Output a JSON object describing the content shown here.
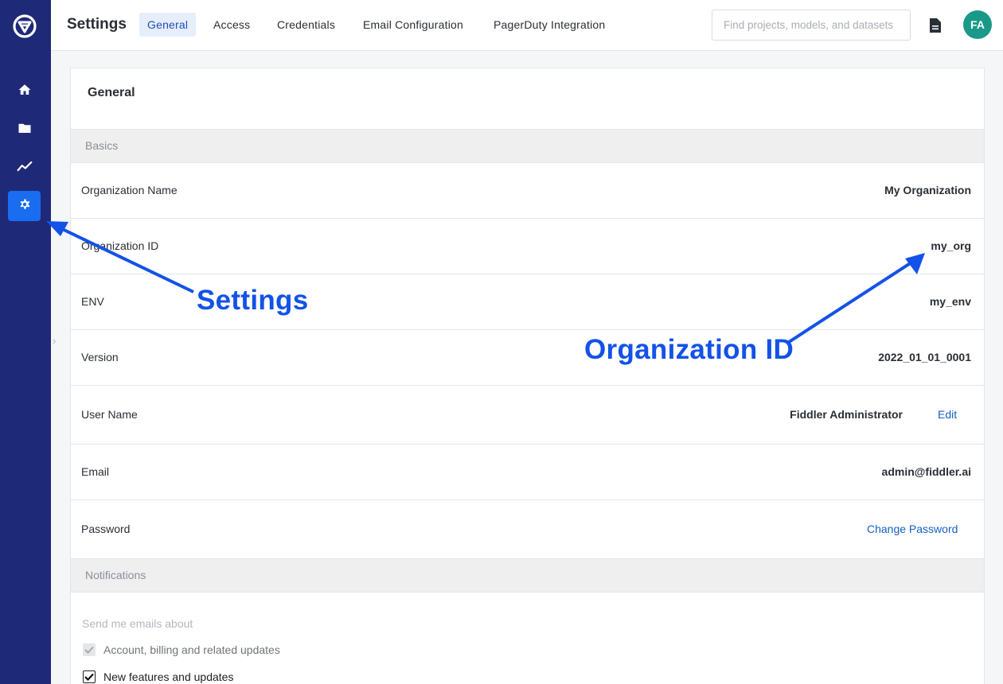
{
  "header": {
    "title": "Settings",
    "tabs": [
      {
        "label": "General",
        "active": true
      },
      {
        "label": "Access",
        "active": false
      },
      {
        "label": "Credentials",
        "active": false
      },
      {
        "label": "Email Configuration",
        "active": false
      },
      {
        "label": "PagerDuty Integration",
        "active": false
      }
    ],
    "search_placeholder": "Find projects, models, and datasets",
    "avatar_initials": "FA"
  },
  "sidebar": {
    "items": [
      {
        "icon": "home-icon",
        "active": false
      },
      {
        "icon": "folder-icon",
        "active": false
      },
      {
        "icon": "chart-line-icon",
        "active": false
      },
      {
        "icon": "gear-icon",
        "active": true
      }
    ]
  },
  "general": {
    "title": "General",
    "basics_heading": "Basics",
    "rows": [
      {
        "label": "Organization Name",
        "value": "My Organization"
      },
      {
        "label": "Organization ID",
        "value": "my_org"
      },
      {
        "label": "ENV",
        "value": "my_env"
      },
      {
        "label": "Version",
        "value": "2022_01_01_0001"
      },
      {
        "label": "User Name",
        "value": "Fiddler Administrator",
        "action": "Edit"
      },
      {
        "label": "Email",
        "value": "admin@fiddler.ai"
      },
      {
        "label": "Password",
        "action": "Change Password"
      }
    ],
    "notifications_heading": "Notifications",
    "notifications_caption": "Send me emails about",
    "notifications": [
      {
        "label": "Account, billing and related updates",
        "checked": true,
        "disabled": true
      },
      {
        "label": "New features and updates",
        "checked": true,
        "disabled": false
      }
    ]
  },
  "annotations": {
    "settings": "Settings",
    "organization_id": "Organization ID"
  },
  "colors": {
    "sidebar": "#1e2a78",
    "accent": "#1a6cf0",
    "annotation": "#1352e8",
    "link": "#1560c4",
    "avatar": "#1a9988"
  }
}
